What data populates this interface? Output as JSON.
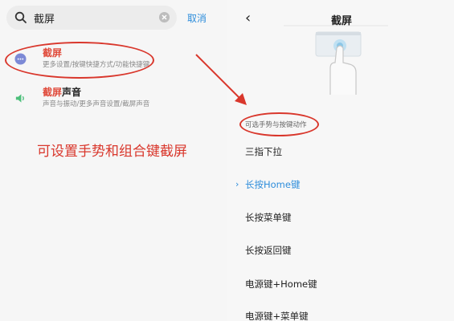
{
  "search": {
    "value": "截屏",
    "cancel_label": "取消"
  },
  "results": [
    {
      "title_highlight": "截屏",
      "title_rest": "",
      "subtitle": "更多设置/按键快捷方式/功能快捷键",
      "icon": "more-dots-icon"
    },
    {
      "title_highlight": "截屏",
      "title_rest": "声音",
      "subtitle": "声音与振动/更多声音设置/截屏声音",
      "icon": "speaker-icon"
    }
  ],
  "annotation": "可设置手势和组合键截屏",
  "right": {
    "title": "截屏",
    "section_label": "可选手势与按键动作",
    "options": [
      {
        "label": "三指下拉",
        "selected": false
      },
      {
        "label": "长按Home键",
        "selected": true
      },
      {
        "label": "长按菜单键",
        "selected": false
      },
      {
        "label": "长按返回键",
        "selected": false
      },
      {
        "label": "电源键+Home键",
        "selected": false
      },
      {
        "label": "电源键+菜单键",
        "selected": false
      }
    ]
  },
  "colors": {
    "accent": "#2e8ddb",
    "highlight": "#e04a3a",
    "annotation": "#d9372c"
  }
}
